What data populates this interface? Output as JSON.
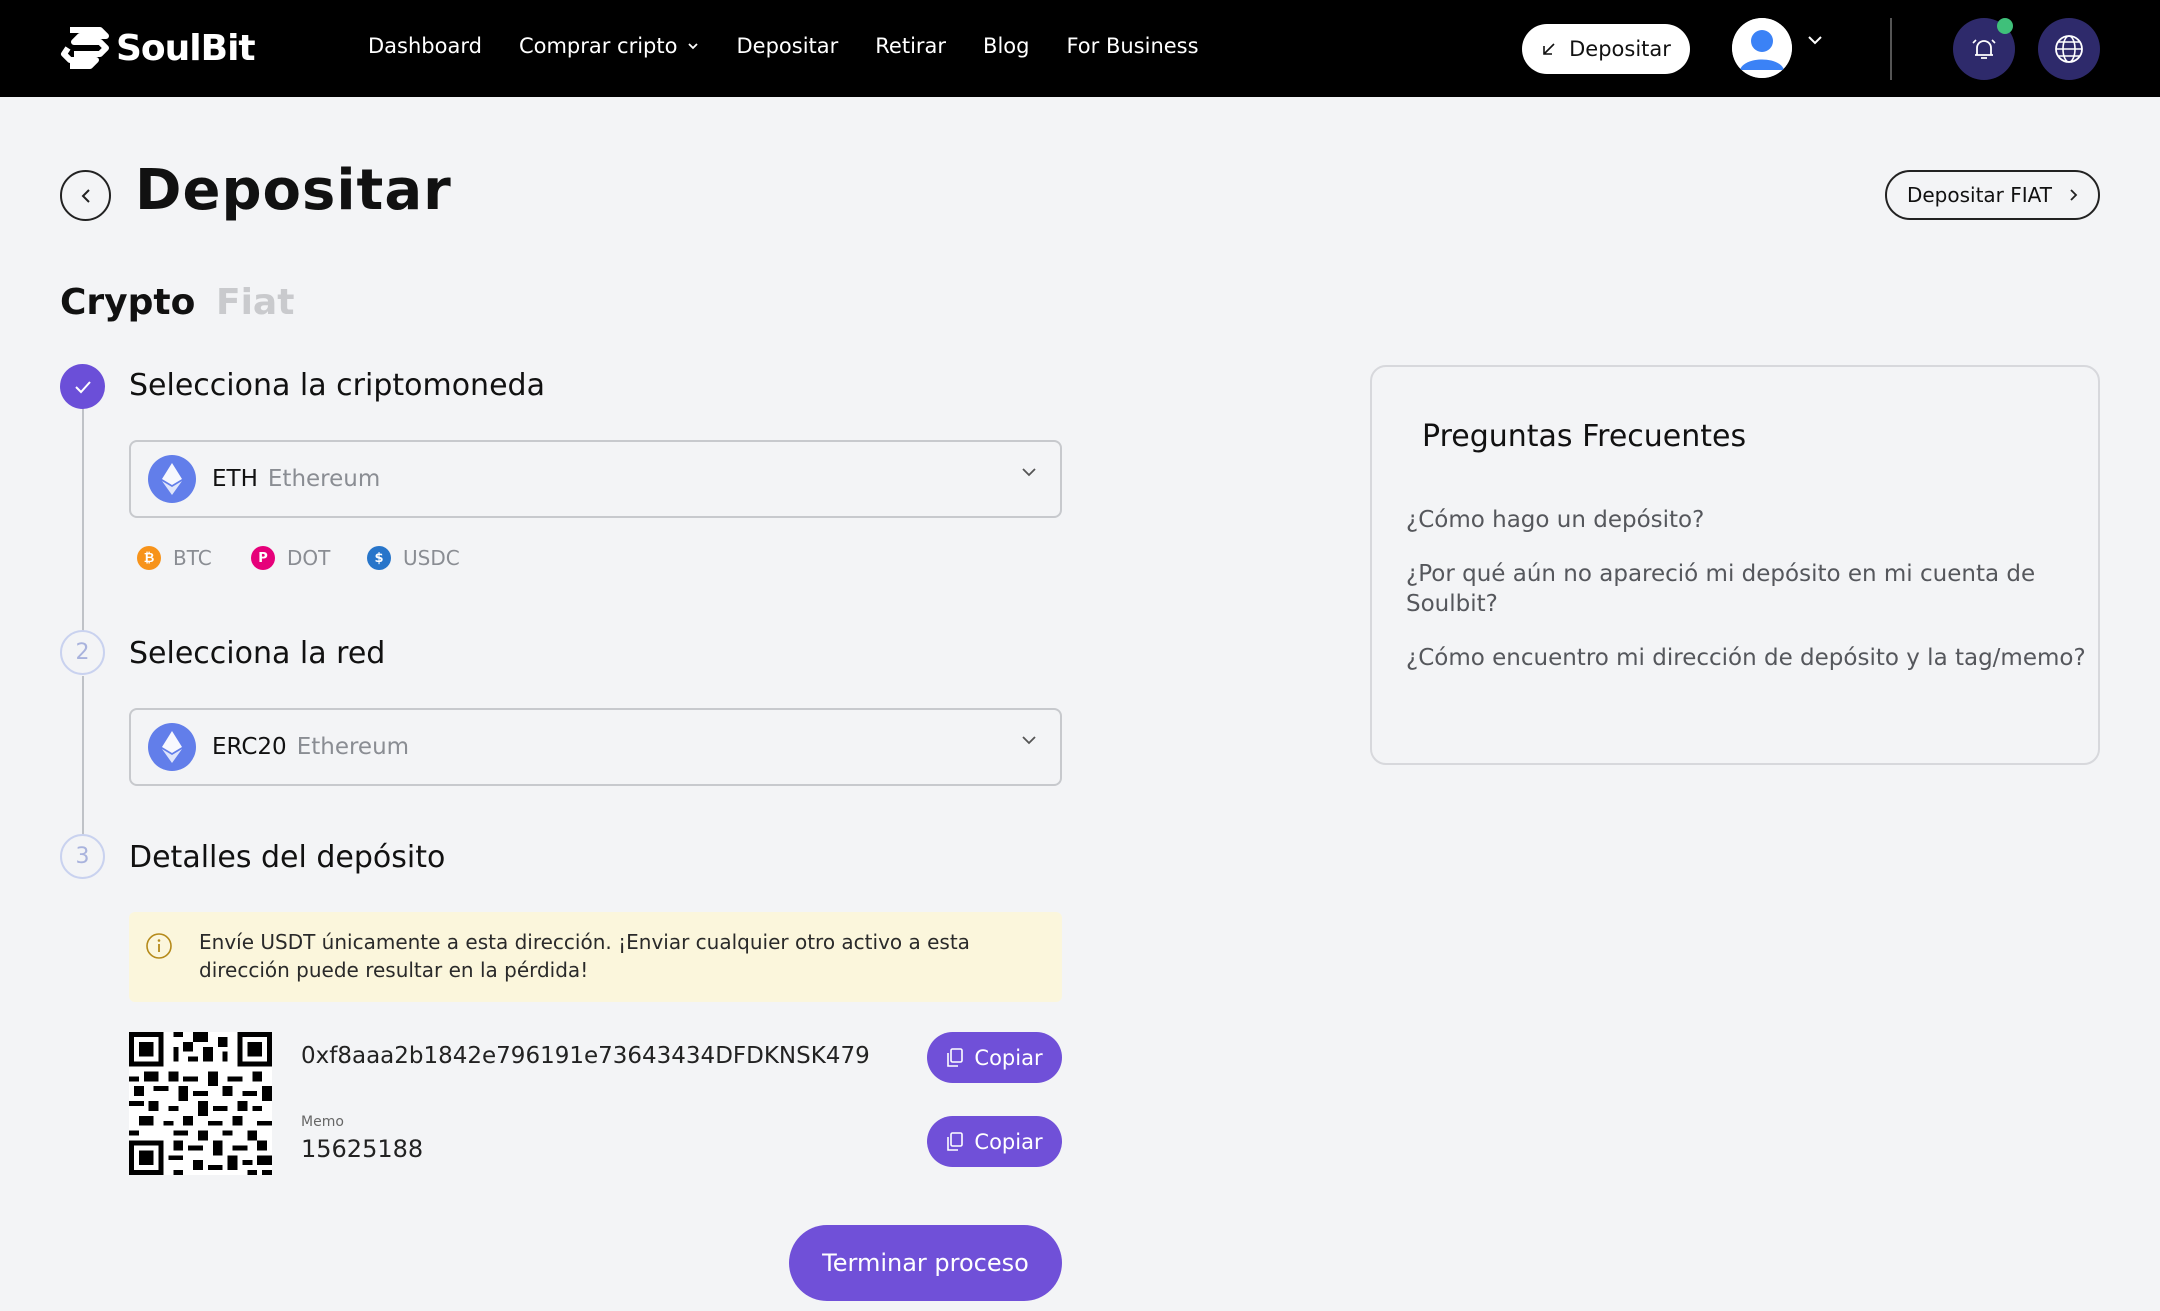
{
  "nav": {
    "brand": "SoulBit",
    "links": [
      "Dashboard",
      "Comprar cripto",
      "Depositar",
      "Retirar",
      "Blog",
      "For Business"
    ],
    "deposit_button": "Depositar"
  },
  "header": {
    "title": "Depositar",
    "fiat_button": "Depositar FIAT"
  },
  "tabs": [
    {
      "label": "Crypto",
      "active": true
    },
    {
      "label": "Fiat",
      "active": false
    }
  ],
  "steps": [
    {
      "number": "1",
      "title": "Selecciona la criptomoneda",
      "status": "done"
    },
    {
      "number": "2",
      "title": "Selecciona la red",
      "status": "pending"
    },
    {
      "number": "3",
      "title": "Detalles del depósito",
      "status": "pending"
    }
  ],
  "crypto_select": {
    "code": "ETH",
    "name": "Ethereum"
  },
  "quick_coins": [
    {
      "label": "BTC",
      "color": "#f7931a",
      "glyph": "₿"
    },
    {
      "label": "DOT",
      "color": "#e6007a",
      "glyph": "P"
    },
    {
      "label": "USDC",
      "color": "#2775ca",
      "glyph": "$"
    }
  ],
  "network_select": {
    "code": "ERC20",
    "name": "Ethereum"
  },
  "warning": {
    "line1": "Envíe USDT únicamente a esta dirección. ¡Enviar cualquier otro activo a esta",
    "line2": "dirección puede resultar en la pérdida!"
  },
  "deposit": {
    "address": "0xf8aaa2b1842e796191e73643434DFDKNSK479",
    "memo_label": "Memo",
    "memo_value": "15625188",
    "copy_label": "Copiar"
  },
  "finish_button": "Terminar proceso",
  "faq": {
    "title": "Preguntas Frecuentes",
    "items": [
      "¿Cómo hago un depósito?",
      "¿Por qué aún no apareció mi depósito en mi cuenta de Soulbit?",
      "¿Cómo encuentro mi dirección de depósito y la tag/memo?"
    ]
  },
  "colors": {
    "accent": "#7050d8",
    "nav_bg": "#000000",
    "notification": "#3fc07a"
  }
}
